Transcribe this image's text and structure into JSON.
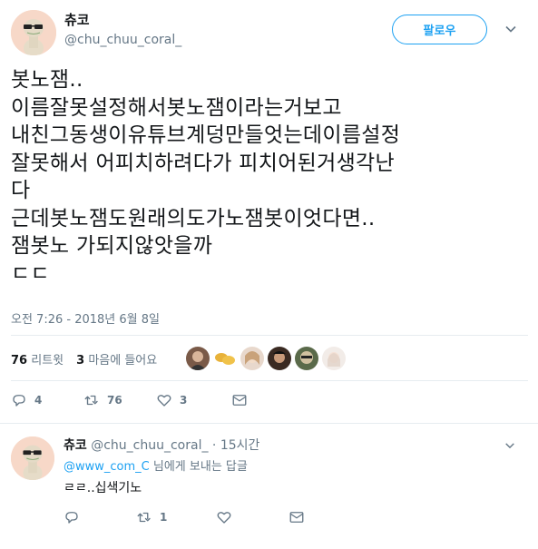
{
  "author": {
    "display_name": "츄코",
    "handle": "@chu_chuu_coral_"
  },
  "follow_label": "팔로우",
  "tweet": {
    "text": "봇노잼..\n이름잘못설정해서봇노잼이라는거보고\n내친그동생이유튜브계덩만들엇는데이름설정\n잘못해서 어피치하려다가 피치어된거생각난\n다\n근데봇노잼도원래의도가노잼봇이엇다면..\n잼봇노 가되지않앗을까\nㄷㄷ",
    "timestamp": "오전 7:26 - 2018년 6월 8일"
  },
  "stats": {
    "retweets_count": "76",
    "retweets_label": "리트윗",
    "likes_count": "3",
    "likes_label": "마음에 들어요"
  },
  "actions": {
    "reply_count": "4",
    "retweet_count": "76",
    "like_count": "3"
  },
  "reply": {
    "display_name": "츄코",
    "handle": "@chu_chuu_coral_",
    "time": "· 15시간",
    "reply_to_user": "@www_com_C",
    "reply_to_suffix": " 님에게 보내는 답글",
    "text": "ㄹㄹ..십색기노",
    "retweet_count": "1"
  },
  "colors": {
    "accent": "#1da1f2",
    "secondary_text": "#657786",
    "divider": "#e6ecf0"
  }
}
